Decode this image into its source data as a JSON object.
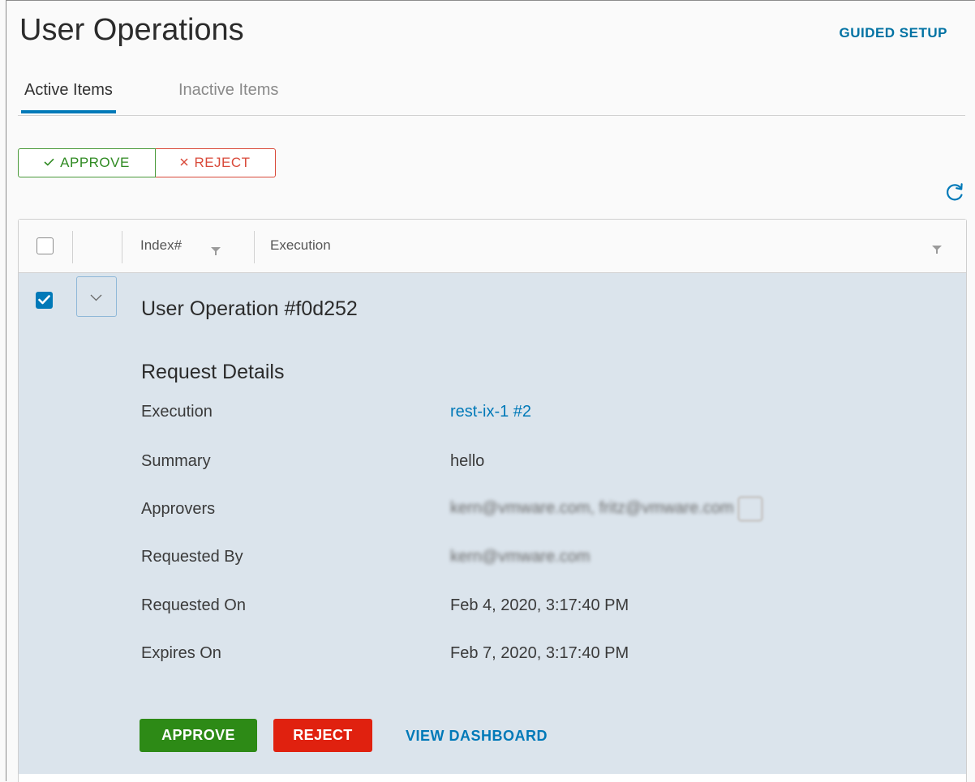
{
  "header": {
    "title": "User Operations",
    "guided_setup_label": "GUIDED SETUP"
  },
  "tabs": [
    {
      "label": "Active Items",
      "active": true
    },
    {
      "label": "Inactive Items",
      "active": false
    }
  ],
  "toolbar": {
    "approve_label": "APPROVE",
    "reject_label": "REJECT",
    "approve_icon": "check-icon",
    "reject_icon": "close-icon",
    "refresh_icon": "refresh-icon"
  },
  "grid": {
    "columns": [
      "Index#",
      "Execution"
    ],
    "rows": [
      {
        "title": "User Operation #f0d252",
        "selected": true,
        "expanded": true,
        "details_title": "Request Details",
        "details": {
          "execution_label": "Execution",
          "execution_value": "rest-ix-1 #2",
          "summary_label": "Summary",
          "summary_value": "hello",
          "approvers_label": "Approvers",
          "approvers_value": "kern@vmware.com, fritz@vmware.com",
          "requested_by_label": "Requested By",
          "requested_by_value": "kern@vmware.com",
          "requested_on_label": "Requested On",
          "requested_on_value": "Feb 4, 2020, 3:17:40 PM",
          "expires_on_label": "Expires On",
          "expires_on_value": "Feb 7, 2020, 3:17:40 PM"
        },
        "actions": {
          "approve_label": "APPROVE",
          "reject_label": "REJECT",
          "dashboard_label": "VIEW DASHBOARD"
        }
      }
    ]
  },
  "colors": {
    "accent": "#0079b8",
    "approve": "#2d8a16",
    "reject": "#e0210f",
    "row_selected_bg": "#dbe4ec"
  }
}
